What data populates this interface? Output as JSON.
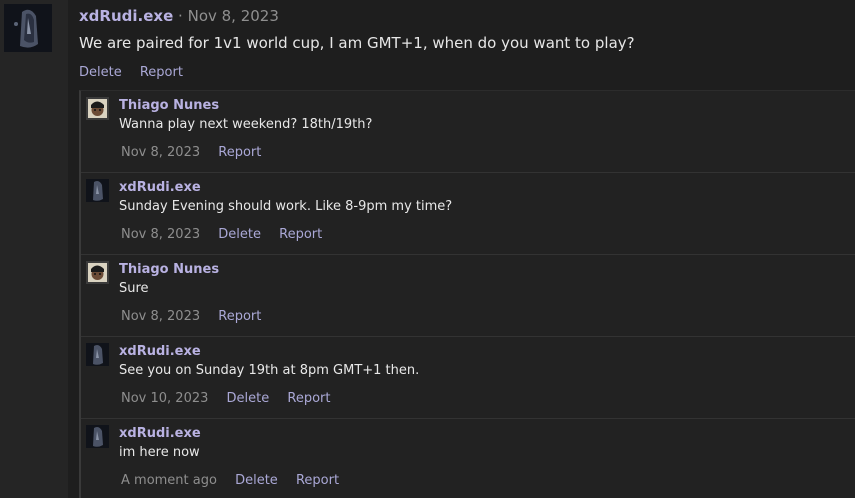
{
  "post": {
    "author": "xdRudi.exe",
    "separator": "·",
    "date": "Nov 8, 2023",
    "body": "We are paired for 1v1 world cup, I am GMT+1, when do you want to play?",
    "delete_label": "Delete",
    "report_label": "Report"
  },
  "replies": [
    {
      "author": "Thiago Nunes",
      "text": "Wanna play next weekend? 18th/19th?",
      "time": "Nov 8, 2023",
      "report_label": "Report"
    },
    {
      "author": "xdRudi.exe",
      "text": "Sunday Evening should work. Like 8-9pm my time?",
      "time": "Nov 8, 2023",
      "delete_label": "Delete",
      "report_label": "Report"
    },
    {
      "author": "Thiago Nunes",
      "text": "Sure",
      "time": "Nov 8, 2023",
      "report_label": "Report"
    },
    {
      "author": "xdRudi.exe",
      "text": "See you on Sunday 19th at 8pm GMT+1 then.",
      "time": "Nov 10, 2023",
      "delete_label": "Delete",
      "report_label": "Report"
    },
    {
      "author": "xdRudi.exe",
      "text": "im here now",
      "time": "A moment ago",
      "delete_label": "Delete",
      "report_label": "Report"
    }
  ],
  "colors": {
    "author_name": "#b9b2e2",
    "action_link": "#aaa8d6",
    "muted_text": "#8e8e8e"
  },
  "icons": {
    "rudi_avatar": "dark-hooded-figure-avatar",
    "thiago_avatar": "cartoon-character-avatar"
  }
}
